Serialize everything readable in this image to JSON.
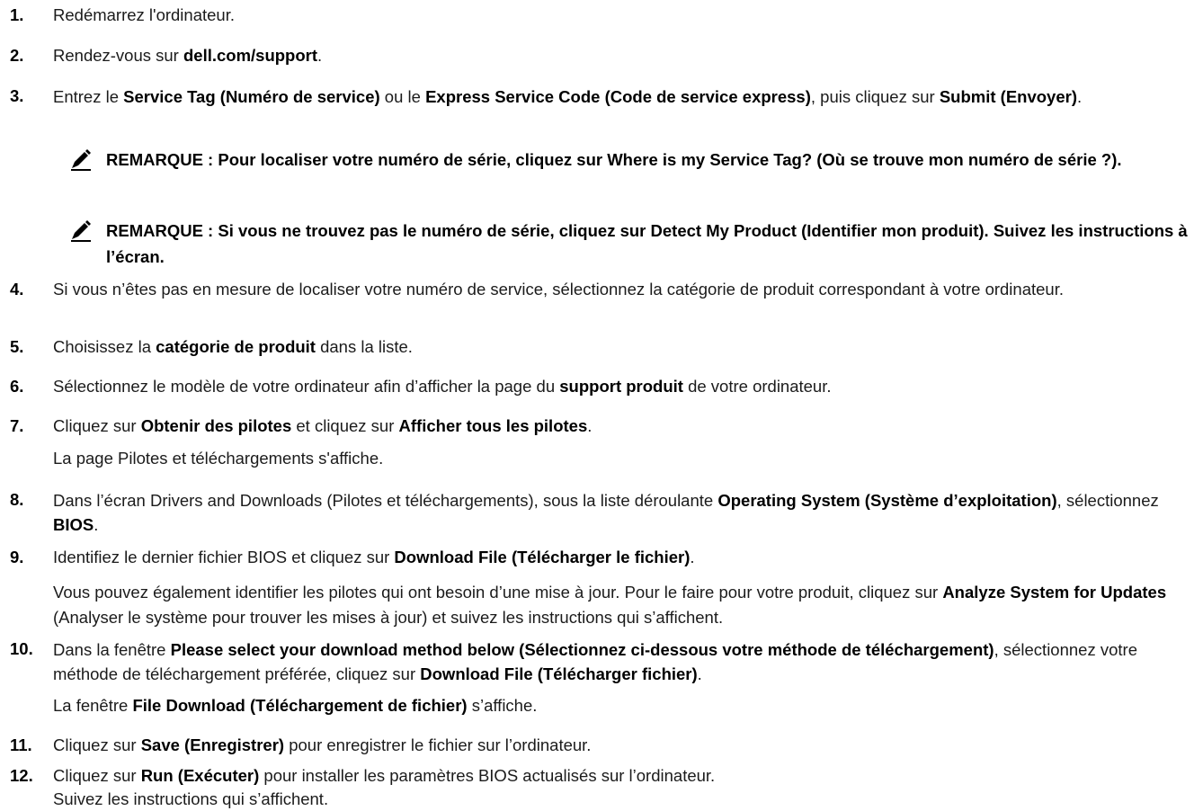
{
  "steps": [
    {
      "num": "1.",
      "parts": [
        {
          "t": "Redémarrez l'ordinateur."
        }
      ]
    },
    {
      "num": "2.",
      "parts": [
        {
          "t": "Rendez-vous sur "
        },
        {
          "t": "dell.com/support",
          "b": true
        },
        {
          "t": "."
        }
      ]
    },
    {
      "num": "3.",
      "parts": [
        {
          "t": "Entrez le "
        },
        {
          "t": "Service Tag (Numéro de service)",
          "b": true
        },
        {
          "t": " ou le "
        },
        {
          "t": "Express Service Code (Code de service express)",
          "b": true
        },
        {
          "t": ", puis cliquez sur "
        },
        {
          "t": "Submit (Envoyer)",
          "b": true
        },
        {
          "t": "."
        }
      ]
    },
    {
      "num": "4.",
      "parts": [
        {
          "t": "Si vous n’êtes pas en mesure de localiser votre numéro de service, sélectionnez la catégorie de produit correspondant à votre ordinateur."
        }
      ]
    },
    {
      "num": "5.",
      "parts": [
        {
          "t": "Choisissez la "
        },
        {
          "t": "catégorie de produit",
          "b": true
        },
        {
          "t": " dans la liste."
        }
      ]
    },
    {
      "num": "6.",
      "parts": [
        {
          "t": "Sélectionnez le modèle de votre ordinateur afin d’afficher la page du "
        },
        {
          "t": "support produit",
          "b": true
        },
        {
          "t": " de votre ordinateur."
        }
      ]
    },
    {
      "num": "7.",
      "parts": [
        {
          "t": "Cliquez sur "
        },
        {
          "t": "Obtenir des pilotes",
          "b": true
        },
        {
          "t": " et cliquez sur "
        },
        {
          "t": "Afficher tous les pilotes",
          "b": true
        },
        {
          "t": "."
        }
      ]
    },
    {
      "num": "8.",
      "parts": [
        {
          "t": "Dans l’écran Drivers and Downloads (Pilotes et téléchargements), sous la liste déroulante "
        },
        {
          "t": "Operating System (Système d’exploitation)",
          "b": true
        },
        {
          "t": ", sélectionnez "
        },
        {
          "t": "BIOS",
          "b": true
        },
        {
          "t": "."
        }
      ]
    },
    {
      "num": "9.",
      "parts": [
        {
          "t": "Identifiez le dernier fichier BIOS et cliquez sur "
        },
        {
          "t": "Download File (Télécharger le fichier)",
          "b": true
        },
        {
          "t": "."
        }
      ]
    },
    {
      "num": "10.",
      "parts": [
        {
          "t": "Dans la fenêtre "
        },
        {
          "t": "Please select your download method below (Sélectionnez ci-dessous votre méthode de téléchargement)",
          "b": true
        },
        {
          "t": ", sélectionnez votre méthode de téléchargement préférée, cliquez sur "
        },
        {
          "t": "Download File (Télécharger fichier)",
          "b": true
        },
        {
          "t": "."
        }
      ]
    },
    {
      "num": "11.",
      "parts": [
        {
          "t": "Cliquez sur "
        },
        {
          "t": "Save (Enregistrer)",
          "b": true
        },
        {
          "t": " pour enregistrer le fichier sur l’ordinateur."
        }
      ]
    },
    {
      "num": "12.",
      "parts": [
        {
          "t": "Cliquez sur "
        },
        {
          "t": "Run (Exécuter)",
          "b": true
        },
        {
          "t": " pour installer les paramètres BIOS actualisés sur l’ordinateur."
        }
      ]
    }
  ],
  "notes": [
    {
      "icon": "pencil-icon",
      "text": "REMARQUE : Pour localiser votre numéro de série, cliquez sur Where is my Service Tag? (Où se trouve mon numéro de série ?)."
    },
    {
      "icon": "pencil-icon",
      "text": "REMARQUE : Si vous ne trouvez pas le numéro de série, cliquez sur Detect My Product (Identifier mon produit). Suivez les instructions à l’écran."
    }
  ],
  "subs": {
    "step7": [
      {
        "t": "La page Pilotes et téléchargements s'affiche."
      }
    ],
    "step9": [
      {
        "t": "Vous pouvez également identifier les pilotes qui ont besoin d’une mise à jour. Pour le faire pour votre produit, cliquez sur "
      },
      {
        "t": "Analyze System for Updates",
        "b": true
      },
      {
        "t": " (Analyser le système pour trouver les mises à jour) et suivez les instructions qui s’affichent."
      }
    ],
    "step10": [
      {
        "t": "La fenêtre "
      },
      {
        "t": "File Download (Téléchargement de fichier)",
        "b": true
      },
      {
        "t": " s’affiche."
      }
    ],
    "step12": [
      {
        "t": "Suivez les instructions qui s’affichent."
      }
    ]
  },
  "colors": {
    "text": "#1b1b1b",
    "bold": "#000000",
    "icon": "#000000"
  }
}
